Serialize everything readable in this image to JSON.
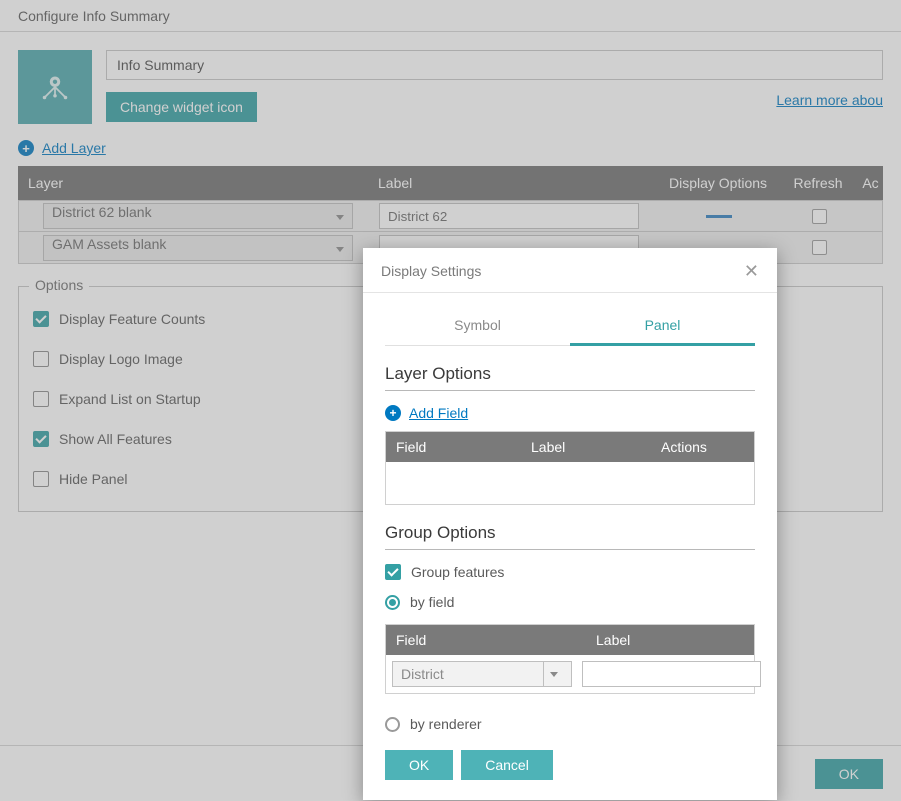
{
  "colors": {
    "teal": "#34a0a4",
    "link": "#0079c1"
  },
  "titlebar": "Configure Info Summary",
  "header": {
    "name_value": "Info Summary",
    "change_icon": "Change widget icon",
    "learn_more": "Learn more abou"
  },
  "add_layer": "Add Layer",
  "layers_head": {
    "layer": "Layer",
    "label": "Label",
    "display": "Display Options",
    "refresh": "Refresh",
    "actions": "Ac"
  },
  "layers": [
    {
      "name": "District 62 blank",
      "label": "District 62",
      "refresh": false
    },
    {
      "name": "GAM Assets blank",
      "label": "",
      "refresh": false
    }
  ],
  "options_legend": "Options",
  "options": [
    {
      "label": "Display Feature Counts",
      "checked": true
    },
    {
      "label": "Display Logo Image",
      "checked": false
    },
    {
      "label": "Expand List on Startup",
      "checked": false
    },
    {
      "label": "Show All Features",
      "checked": true
    },
    {
      "label": "Hide Panel",
      "checked": false
    }
  ],
  "footer": {
    "ok": "OK"
  },
  "modal": {
    "title": "Display Settings",
    "tabs": {
      "symbol": "Symbol",
      "panel": "Panel",
      "active": "panel"
    },
    "layer_options": {
      "heading": "Layer Options",
      "add_field": "Add Field",
      "cols": {
        "field": "Field",
        "label": "Label",
        "actions": "Actions"
      }
    },
    "group_options": {
      "heading": "Group Options",
      "group_features": {
        "label": "Group features",
        "checked": true
      },
      "mode": "field",
      "by_field": "by field",
      "by_renderer": "by renderer",
      "cols": {
        "field": "Field",
        "label": "Label"
      },
      "row": {
        "field": "District",
        "label": ""
      }
    },
    "footer": {
      "ok": "OK",
      "cancel": "Cancel"
    }
  }
}
